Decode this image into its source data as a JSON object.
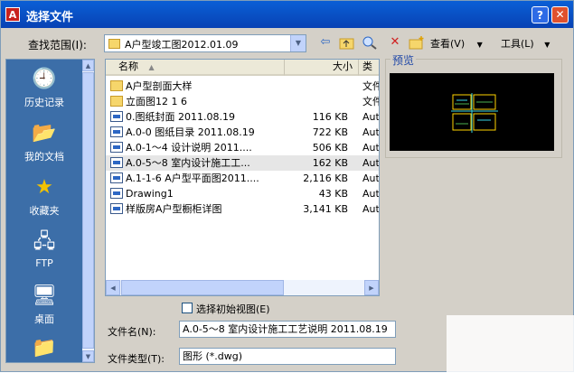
{
  "window": {
    "title": "选择文件",
    "app_icon": "A",
    "help_glyph": "?",
    "close_glyph": "✕"
  },
  "toolbar": {
    "lookin_label": "查找范围(I):",
    "lookin_value": "A户型竣工图2012.01.09",
    "back_icon": "back-arrow-icon",
    "up_icon": "folder-up-icon",
    "search_icon": "search-web-icon",
    "delete_icon": "delete-icon",
    "newfolder_icon": "new-folder-icon",
    "views_label": "查看(V)",
    "tools_label": "工具(L)"
  },
  "places": [
    {
      "label": "历史记录",
      "icon": "history-icon"
    },
    {
      "label": "我的文档",
      "icon": "my-documents-icon"
    },
    {
      "label": "收藏夹",
      "icon": "favorites-star-icon"
    },
    {
      "label": "FTP",
      "icon": "ftp-icon"
    },
    {
      "label": "桌面",
      "icon": "desktop-icon"
    }
  ],
  "filelist": {
    "columns": [
      "名称",
      "大小",
      "类"
    ],
    "rows": [
      {
        "name": "A户型剖面大样",
        "size": "",
        "type": "文件",
        "kind": "folder"
      },
      {
        "name": "立面图12 1 6",
        "size": "",
        "type": "文件",
        "kind": "folder"
      },
      {
        "name": "0.图纸封面 2011.08.19",
        "size": "116 KB",
        "type": "Aut",
        "kind": "dwg"
      },
      {
        "name": "A.0-0 图纸目录 2011.08.19",
        "size": "722 KB",
        "type": "Aut",
        "kind": "dwg"
      },
      {
        "name": "A.0-1～4 设计说明 2011....",
        "size": "506 KB",
        "type": "Aut",
        "kind": "dwg"
      },
      {
        "name": "A.0-5～8 室内设计施工工...",
        "size": "162 KB",
        "type": "Aut",
        "kind": "dwg",
        "selected": true
      },
      {
        "name": "A.1-1-6 A户型平面图2011....",
        "size": "2,116 KB",
        "type": "Aut",
        "kind": "dwg"
      },
      {
        "name": "Drawing1",
        "size": "43 KB",
        "type": "Aut",
        "kind": "dwg"
      },
      {
        "name": "样版房A户型橱柜详图",
        "size": "3,141 KB",
        "type": "Aut",
        "kind": "dwg"
      }
    ]
  },
  "preview": {
    "label": "预览"
  },
  "initial_view": {
    "label": "选择初始视图(E)",
    "checked": false
  },
  "filename": {
    "label": "文件名(N):",
    "value": "A.0-5～8 室内设计施工工艺说明 2011.08.19"
  },
  "filetype": {
    "label": "文件类型(T):",
    "value": "图形 (*.dwg)"
  },
  "colors": {
    "title_bar": "#0842b4",
    "places_bg": "#3c6ea8",
    "dialog_bg": "#d4d0c8"
  }
}
